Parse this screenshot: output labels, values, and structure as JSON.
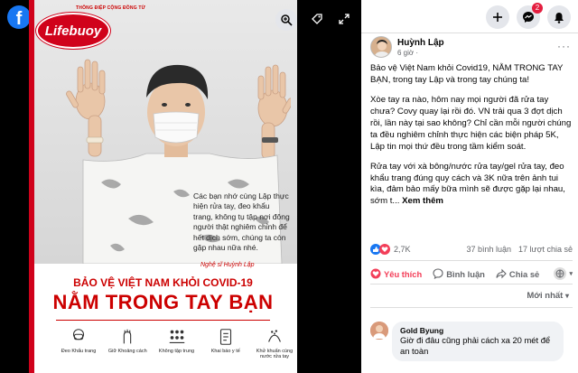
{
  "viewer": {
    "logo": "f",
    "zoom_icon": "zoom-in-icon",
    "tag_icon": "tag-icon",
    "fullscreen_icon": "fullscreen-icon"
  },
  "poster": {
    "tagline": "THÔNG ĐIỆP CỘNG ĐỒNG TỪ",
    "brand": "Lifebuoy",
    "quote": "Các bạn nhớ cùng Lập thực hiện rửa tay, đeo khẩu trang, không tụ tập nơi đông người thật nghiêm chỉnh để hết dịch sớm, chúng ta còn gặp nhau nữa nhé.",
    "quote_by": "Nghệ sĩ Huỳnh Lập",
    "sub_head": "BẢO VỆ VIỆT NAM KHỎI COVID-19",
    "main_head": "NẰM TRONG TAY BẠN",
    "steps": [
      {
        "label": "Đeo Khẩu trang",
        "icon": "mask-icon"
      },
      {
        "label": "Giữ Khoảng cách",
        "icon": "distance-icon"
      },
      {
        "label": "Không tập trung",
        "icon": "no-gathering-icon"
      },
      {
        "label": "Khai báo y tế",
        "icon": "health-declaration-icon"
      },
      {
        "label": "Khử khuẩn cùng nước rửa tay",
        "icon": "sanitize-hands-icon"
      }
    ],
    "colors": {
      "brand_red": "#d0021b",
      "poster_bg": "#e9e9e9"
    }
  },
  "topbar": {
    "create_icon": "plus-icon",
    "messenger_icon": "messenger-icon",
    "messenger_badge": "2",
    "notifications_icon": "bell-icon"
  },
  "post": {
    "author": "Huỳnh Lập",
    "time": "6 giờ ·",
    "more": "···",
    "paragraphs": [
      "Bảo vệ Việt Nam khỏi Covid19, NẰM TRONG TAY BẠN, trong tay Lập và trong tay chúng ta!",
      "Xòe tay ra nào, hôm nay mọi người đã rửa tay chưa? Covy quay lại rồi đó. VN trải qua 3 đợt dịch rồi, lần này tại sao không? Chỉ cần mỗi người chúng ta đều nghiêm chỉnh thực hiện các biện pháp 5K, Lập tin mọi thứ đều trong tầm kiểm soát.",
      "Rửa tay với xà bông/nước rửa tay/gel rửa tay, đeo khẩu trang đúng quy cách và 3K nữa trên ảnh tui kìa, đảm bảo mấy bữa mình sẽ được gặp lại nhau, sớm t..."
    ],
    "see_more": "Xem thêm",
    "reaction_count": "2,7K",
    "comments_count": "37 bình luận",
    "shares_count": "17 lượt chia sẻ",
    "actions": {
      "like": "Yêu thích",
      "comment": "Bình luận",
      "share": "Chia sẻ"
    },
    "sort_label": "Mới nhất",
    "colors": {
      "like_pink": "#f33e58",
      "link_blue": "#1877f2"
    }
  },
  "comment": {
    "name": "Gold Byung",
    "text": "Giờ đi đâu cũng phải cách xa 20 mét để an toàn"
  }
}
